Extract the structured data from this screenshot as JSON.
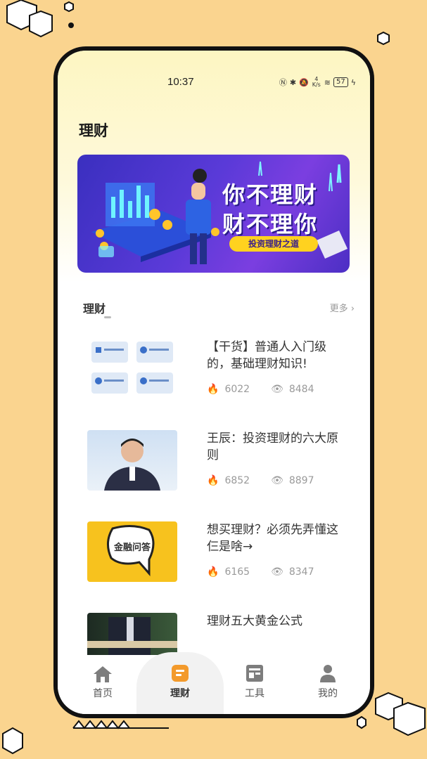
{
  "status_bar": {
    "time": "10:37",
    "net_speed": "4 K/s",
    "battery": "57"
  },
  "page": {
    "title": "理财"
  },
  "banner": {
    "line1": "你不理财",
    "line2": "财不理你",
    "button": "投资理财之道"
  },
  "section": {
    "title": "理财",
    "more": "更多"
  },
  "articles": [
    {
      "title": "【干货】普通人入门级的，基础理财知识!",
      "likes": "6022",
      "views": "8484",
      "thumb_icon": "cards-icon"
    },
    {
      "title": "王辰：投资理财的六大原则",
      "likes": "6852",
      "views": "8897",
      "thumb_icon": "person-photo"
    },
    {
      "title": "想买理财？必须先弄懂这仨是啥→",
      "likes": "6165",
      "views": "8347",
      "thumb_icon": "speech-bubble",
      "thumb_text": "金融问答"
    },
    {
      "title": "理财五大黄金公式",
      "thumb_icon": "person-photo"
    }
  ],
  "tabs": [
    {
      "label": "首页",
      "icon": "home-icon"
    },
    {
      "label": "理财",
      "icon": "finance-icon",
      "active": true
    },
    {
      "label": "工具",
      "icon": "tools-icon"
    },
    {
      "label": "我的",
      "icon": "user-icon"
    }
  ],
  "colors": {
    "background": "#FAD48F",
    "accent": "#F39A2B",
    "banner": "#5A3AD8"
  }
}
